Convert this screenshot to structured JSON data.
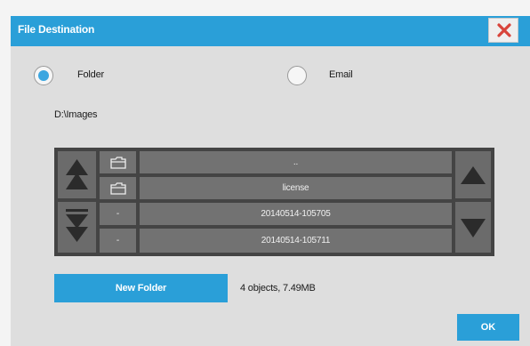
{
  "dialog": {
    "title": "File Destination",
    "close_icon": "close-x-icon"
  },
  "destination": {
    "folder_label": "Folder",
    "email_label": "Email",
    "selected": "Folder",
    "path": "D:\\Images"
  },
  "browser": {
    "rows": [
      {
        "type_icon": "folder-icon",
        "name": ".."
      },
      {
        "type_icon": "folder-icon",
        "name": "license"
      },
      {
        "type_icon": "-",
        "name": "20140514-105705"
      },
      {
        "type_icon": "-",
        "name": "20140514-105711"
      }
    ],
    "nav_icons": {
      "left_top": "page-up-icon",
      "left_bottom": "page-down-icon",
      "right_top": "scroll-up-icon",
      "right_bottom": "scroll-down-icon"
    }
  },
  "actions": {
    "new_folder_label": "New Folder",
    "ok_label": "OK"
  },
  "status": {
    "summary": "4 objects, 7.49MB"
  },
  "colors": {
    "accent": "#2a9fd8",
    "close_icon": "#d8443b",
    "panel_bg": "#444444",
    "cell_bg": "#727272"
  }
}
